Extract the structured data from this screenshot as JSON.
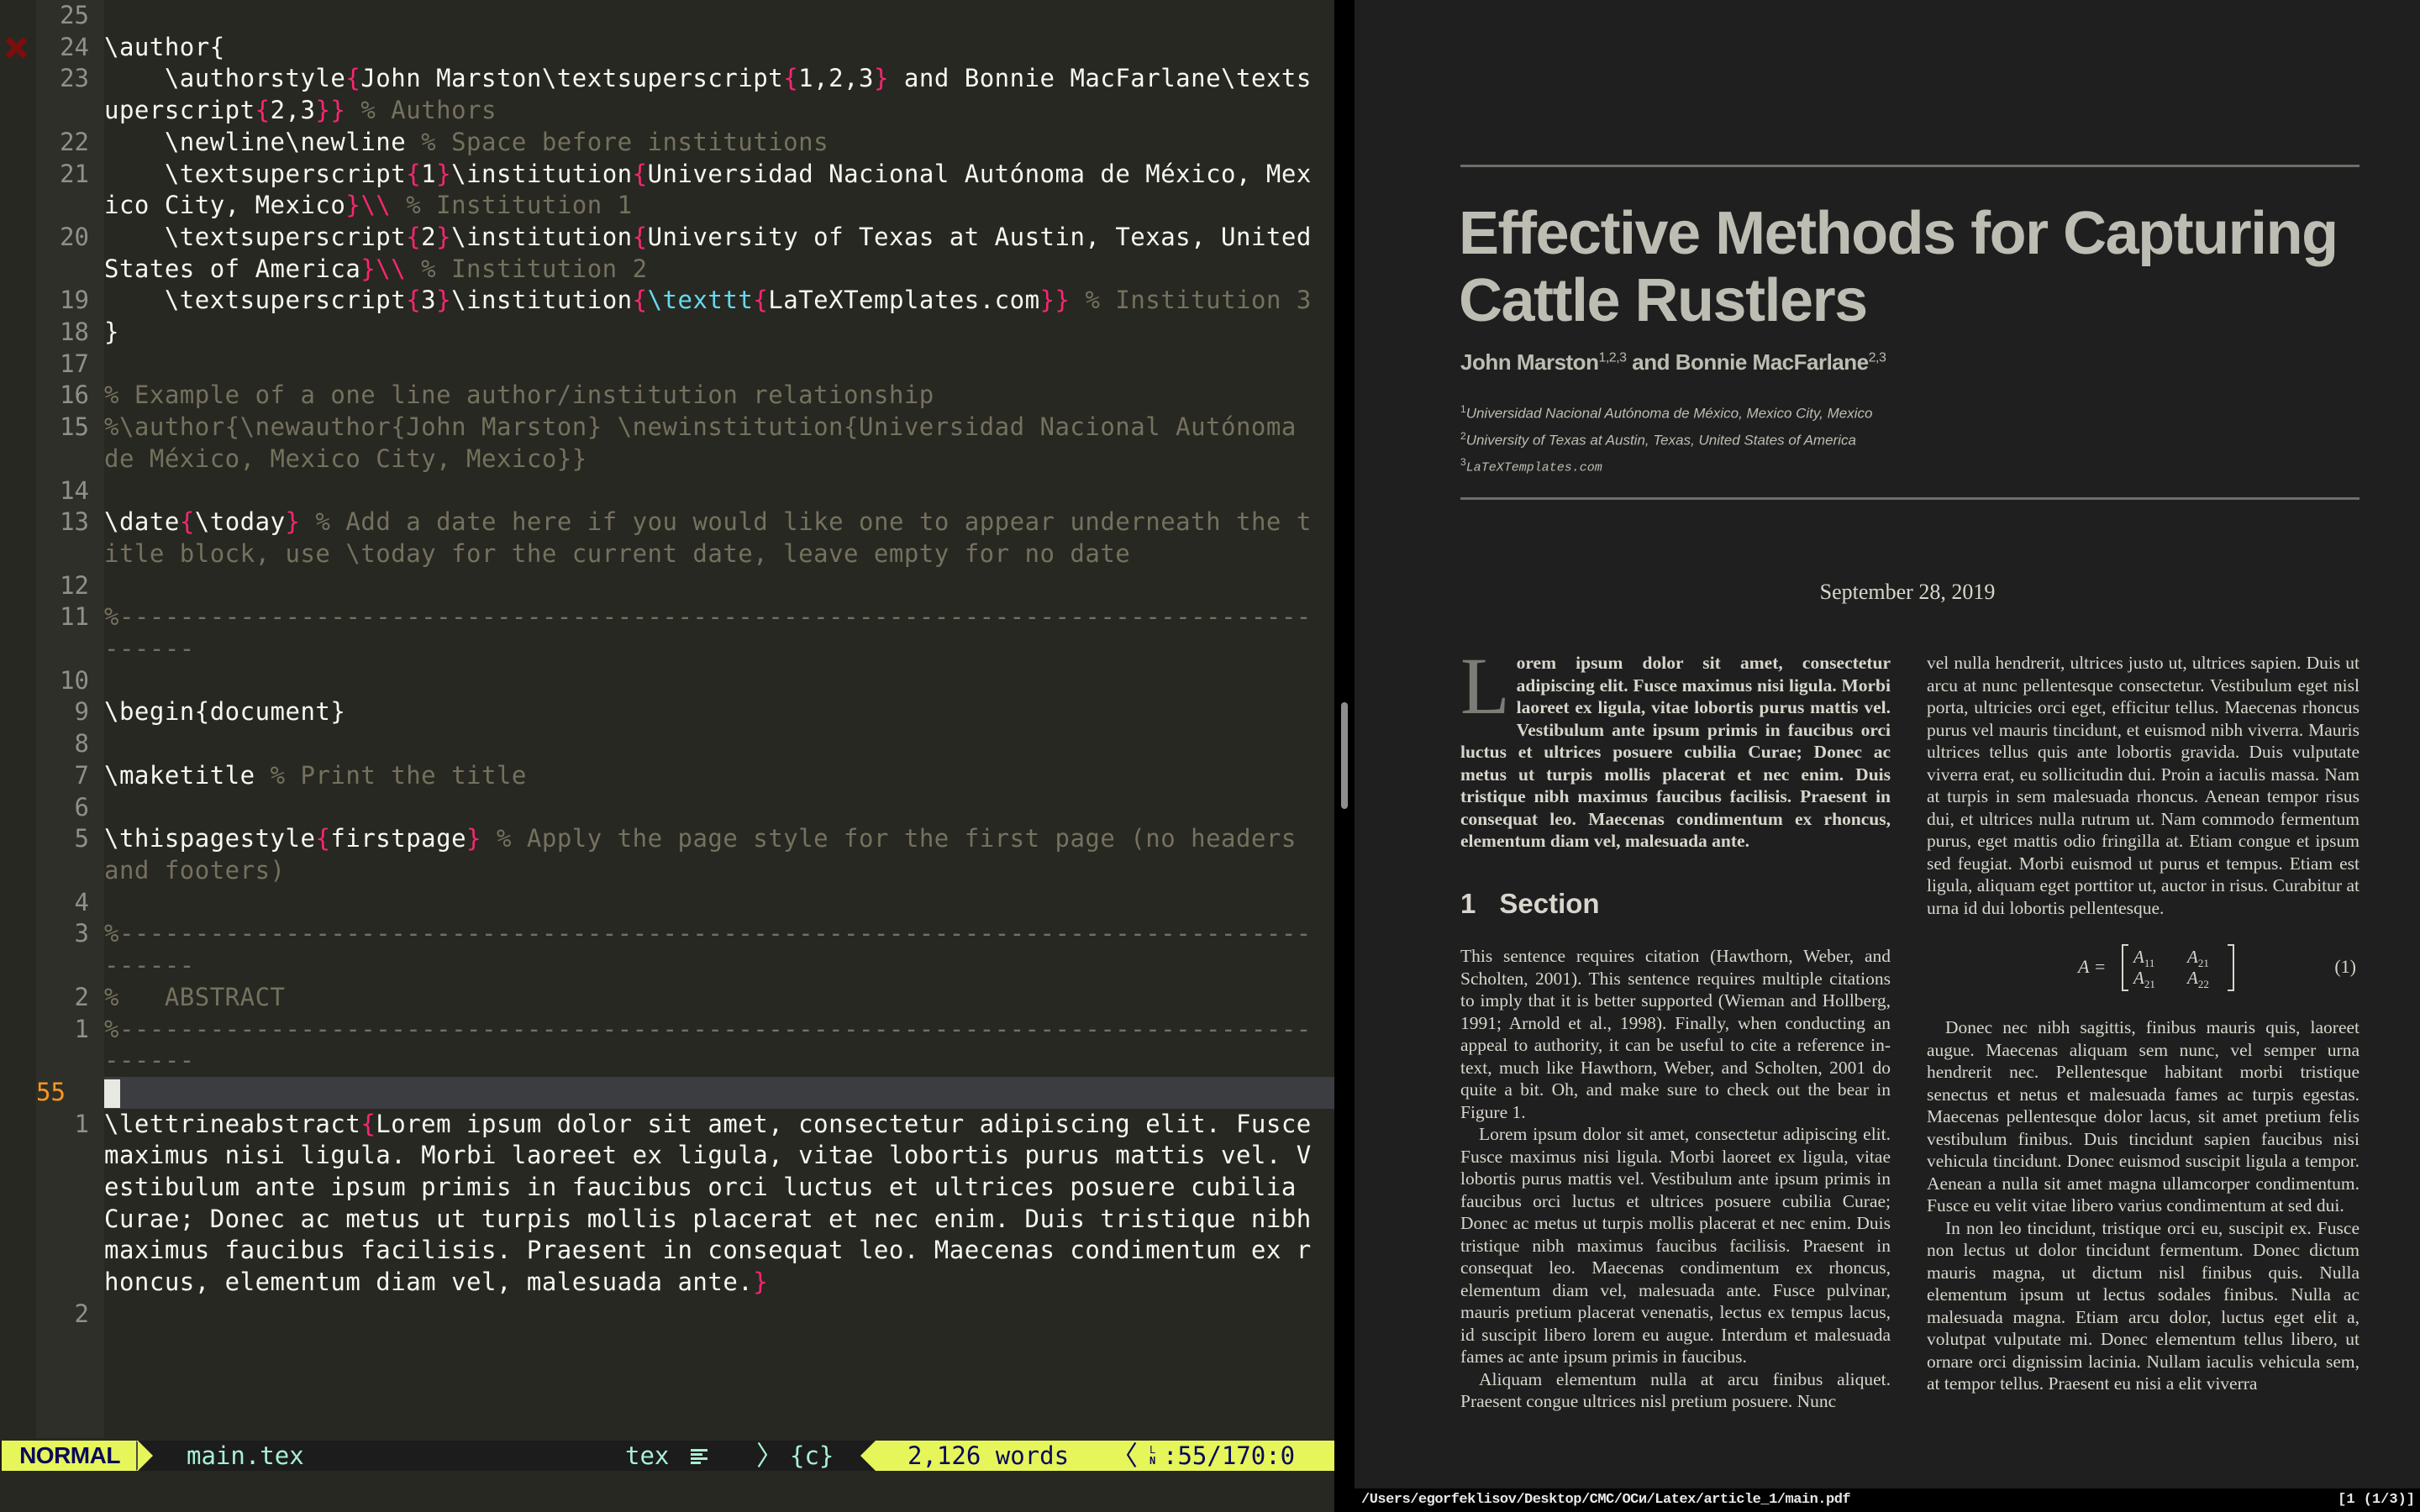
{
  "editor": {
    "sign_icon": "error-x-icon",
    "lines": [
      {
        "ln": "25",
        "segs": []
      },
      {
        "ln": "24",
        "sign": true,
        "segs": [
          [
            "t",
            "\\author"
          ],
          [
            "t",
            "{"
          ]
        ]
      },
      {
        "ln": "23",
        "segs": [
          [
            "t",
            "    \\authorstyle"
          ],
          [
            "b",
            "{"
          ],
          [
            "t",
            "John Marston\\textsuperscript"
          ],
          [
            "b",
            "{"
          ],
          [
            "t",
            "1,2,3"
          ],
          [
            "b",
            "}"
          ],
          [
            "t",
            " and Bonnie MacFarlane\\textsuperscript"
          ],
          [
            "b",
            "{"
          ],
          [
            "t",
            "2,3"
          ],
          [
            "b",
            "}}"
          ],
          [
            "t",
            " "
          ],
          [
            "c",
            "% Authors"
          ]
        ]
      },
      {
        "ln": "22",
        "segs": [
          [
            "t",
            "    \\newline\\newline "
          ],
          [
            "c",
            "% Space before institutions"
          ]
        ]
      },
      {
        "ln": "21",
        "segs": [
          [
            "t",
            "    \\textsuperscript"
          ],
          [
            "b",
            "{"
          ],
          [
            "t",
            "1"
          ],
          [
            "b",
            "}"
          ],
          [
            "t",
            "\\institution"
          ],
          [
            "b",
            "{"
          ],
          [
            "t",
            "Universidad Nacional Autónoma de México, Mexico City, Mexico"
          ],
          [
            "b",
            "}\\\\"
          ],
          [
            "t",
            " "
          ],
          [
            "c",
            "% Institution 1"
          ]
        ]
      },
      {
        "ln": "20",
        "segs": [
          [
            "t",
            "    \\textsuperscript"
          ],
          [
            "b",
            "{"
          ],
          [
            "t",
            "2"
          ],
          [
            "b",
            "}"
          ],
          [
            "t",
            "\\institution"
          ],
          [
            "b",
            "{"
          ],
          [
            "t",
            "University of Texas at Austin, Texas, United States of America"
          ],
          [
            "b",
            "}\\\\"
          ],
          [
            "t",
            " "
          ],
          [
            "c",
            "% Institution 2"
          ]
        ]
      },
      {
        "ln": "19",
        "segs": [
          [
            "t",
            "    \\textsuperscript"
          ],
          [
            "b",
            "{"
          ],
          [
            "t",
            "3"
          ],
          [
            "b",
            "}"
          ],
          [
            "t",
            "\\institution"
          ],
          [
            "b",
            "{"
          ],
          [
            "k",
            "\\texttt"
          ],
          [
            "b",
            "{"
          ],
          [
            "t",
            "LaTeXTemplates.com"
          ],
          [
            "b",
            "}}"
          ],
          [
            "t",
            " "
          ],
          [
            "c",
            "% Institution 3"
          ]
        ]
      },
      {
        "ln": "18",
        "segs": [
          [
            "t",
            "}"
          ]
        ]
      },
      {
        "ln": "17",
        "segs": []
      },
      {
        "ln": "16",
        "segs": [
          [
            "c",
            "% Example of a one line author/institution relationship"
          ]
        ]
      },
      {
        "ln": "15",
        "segs": [
          [
            "c",
            "%\\author{\\newauthor{John Marston} \\newinstitution{Universidad Nacional Autónoma de México, Mexico City, Mexico}}"
          ]
        ]
      },
      {
        "ln": "14",
        "segs": []
      },
      {
        "ln": "13",
        "segs": [
          [
            "t",
            "\\date"
          ],
          [
            "b",
            "{"
          ],
          [
            "t",
            "\\today"
          ],
          [
            "b",
            "}"
          ],
          [
            "t",
            " "
          ],
          [
            "c",
            "% Add a date here if you would like one to appear underneath the title block, use \\today for the current date, leave empty for no date"
          ]
        ]
      },
      {
        "ln": "12",
        "segs": []
      },
      {
        "ln": "11",
        "segs": [
          [
            "c",
            "%-------------------------------------------------------------------------------------"
          ]
        ]
      },
      {
        "ln": "10",
        "segs": []
      },
      {
        "ln": "9",
        "segs": [
          [
            "t",
            "\\begin{document}"
          ]
        ]
      },
      {
        "ln": "8",
        "segs": []
      },
      {
        "ln": "7",
        "segs": [
          [
            "t",
            "\\maketitle "
          ],
          [
            "c",
            "% Print the title"
          ]
        ]
      },
      {
        "ln": "6",
        "segs": []
      },
      {
        "ln": "5",
        "segs": [
          [
            "t",
            "\\thispagestyle"
          ],
          [
            "b",
            "{"
          ],
          [
            "t",
            "firstpage"
          ],
          [
            "b",
            "}"
          ],
          [
            "t",
            " "
          ],
          [
            "c",
            "% Apply the page style for the first page (no headers and footers)"
          ]
        ]
      },
      {
        "ln": "4",
        "segs": []
      },
      {
        "ln": "3",
        "segs": [
          [
            "c",
            "%-------------------------------------------------------------------------------------"
          ]
        ]
      },
      {
        "ln": "2",
        "segs": [
          [
            "c",
            "%   ABSTRACT"
          ]
        ]
      },
      {
        "ln": "1",
        "segs": [
          [
            "c",
            "%-------------------------------------------------------------------------------------"
          ]
        ]
      },
      {
        "ln": "55",
        "cursor": true,
        "segs": []
      },
      {
        "ln": "1",
        "segs": [
          [
            "t",
            "\\lettrineabstract"
          ],
          [
            "b",
            "{"
          ],
          [
            "t",
            "Lorem ipsum dolor sit amet, consectetur adipiscing elit. Fusce maximus nisi ligula. Morbi laoreet ex ligula, vitae lobortis purus mattis vel. Vestibulum ante ipsum primis in faucibus orci luctus et ultrices posuere cubilia Curae; Donec ac metus ut turpis mollis placerat et nec enim. Duis tristique nibh maximus faucibus facilisis. Praesent in consequat leo. Maecenas condimentum ex rhoncus, elementum diam vel, malesuada ante."
          ],
          [
            "b",
            "}"
          ]
        ]
      },
      {
        "ln": "2",
        "segs": []
      }
    ]
  },
  "statusline": {
    "mode": "NORMAL",
    "filename": "main.tex",
    "filetype": "tex",
    "filetype_icon": "align-left-icon",
    "context": "{c}",
    "word_count": "2,126 words",
    "line_icon": "line-number-icon",
    "line_icon_text": "LN",
    "position": ":55/170:0",
    "colors": {
      "mode_bg": "#e6f55a",
      "mode_fg": "#0a0a5a",
      "info_fg": "#a8f0d4"
    }
  },
  "pdf": {
    "title": "Effective Methods for Capturing Cattle Rustlers",
    "authors": [
      {
        "name": "John Marston",
        "sup": "1,2,3"
      },
      {
        "connector": " and "
      },
      {
        "name": "Bonnie MacFarlane",
        "sup": "2,3"
      }
    ],
    "affiliations": [
      {
        "sup": "1",
        "text": "Universidad Nacional Autónoma de México, Mexico City, Mexico"
      },
      {
        "sup": "2",
        "text": "University of Texas at Austin, Texas, United States of America"
      },
      {
        "sup": "3",
        "text": "LaTeXTemplates.com",
        "mono": true
      }
    ],
    "date": "September 28, 2019",
    "abstract_dropcap": "L",
    "abstract": "orem ipsum dolor sit amet, consectetur adipiscing elit. Fusce maximus nisi ligula. Morbi laoreet ex ligula, vitae lobortis purus mattis vel. Vestibulum ante ipsum primis in faucibus orci luctus et ultrices posuere cubilia Curae; Donec ac metus ut turpis mollis placerat et nec enim. Duis tristique nibh maximus faucibus facilisis. Praesent in consequat leo. Maecenas condimentum ex rhoncus, elementum diam vel, malesuada ante.",
    "section": {
      "number": "1",
      "title": "Section"
    },
    "col1_paragraphs": [
      "This sentence requires citation (Hawthorn, Weber, and Scholten, 2001). This sentence requires multiple citations to imply that it is better supported (Wieman and Hollberg, 1991; Arnold et al., 1998). Finally, when conducting an appeal to authority, it can be useful to cite a reference in-text, much like Hawthorn, Weber, and Scholten, 2001 do quite a bit. Oh, and make sure to check out the bear in Figure 1.",
      "Lorem ipsum dolor sit amet, consectetur adipiscing elit. Fusce maximus nisi ligula. Morbi laoreet ex ligula, vitae lobortis purus mattis vel. Vestibulum ante ipsum primis in faucibus orci luctus et ultrices posuere cubilia Curae; Donec ac metus ut turpis mollis placerat et nec enim. Duis tristique nibh maximus faucibus facilisis. Praesent in consequat leo. Maecenas condimentum ex rhoncus, elementum diam vel, malesuada ante. Fusce pulvinar, mauris pretium placerat venenatis, lectus ex tempus lacus, id suscipit libero lorem eu augue. Interdum et malesuada fames ac ante ipsum primis in faucibus.",
      "Aliquam elementum nulla at arcu finibus aliquet. Praesent congue ultrices nisl pretium posuere. Nunc"
    ],
    "col2_top": "vel nulla hendrerit, ultrices justo ut, ultrices sapien. Duis ut arcu at nunc pellentesque consectetur. Vestibulum eget nisl porta, ultricies orci eget, efficitur tellus. Maecenas rhoncus purus vel mauris tincidunt, et euismod nibh viverra. Mauris ultrices tellus quis ante lobortis gravida. Duis vulputate viverra erat, eu sollicitudin dui. Proin a iaculis massa. Nam at turpis in sem malesuada rhoncus. Aenean tempor risus dui, et ultrices nulla rutrum ut. Nam commodo fermentum purus, eget mattis odio fringilla at. Etiam congue et ipsum sed feugiat. Morbi euismod ut purus et tempus. Etiam est ligula, aliquam eget porttitor ut, auctor in risus. Curabitur at urna id dui lobortis pellentesque.",
    "equation": {
      "lhs": "A =",
      "cells": [
        [
          "A",
          "11"
        ],
        [
          "A",
          "21"
        ],
        [
          "A",
          "21"
        ],
        [
          "A",
          "22"
        ]
      ],
      "number": "(1)"
    },
    "col2_paragraphs": [
      "Donec nec nibh sagittis, finibus mauris quis, laoreet augue. Maecenas aliquam sem nunc, vel semper urna hendrerit nec. Pellentesque habitant morbi tristique senectus et netus et malesuada fames ac turpis egestas. Maecenas pellentesque dolor lacus, sit amet pretium felis vestibulum finibus. Duis tincidunt sapien faucibus nisi vehicula tincidunt. Donec euismod suscipit ligula a tempor. Aenean a nulla sit amet magna ullamcorper condimentum. Fusce eu velit vitae libero varius condimentum at sed dui.",
      "In non leo tincidunt, tristique orci eu, suscipit ex. Fusce non lectus ut dolor tincidunt fermentum. Donec dictum mauris magna, ut dictum nisl finibus quis. Nulla elementum ipsum ut lectus sodales finibus. Nulla ac malesuada magna. Etiam arcu dolor, luctus eget elit a, volutpat vulputate mi. Donec elementum tellus libero, ut ornare orci dignissim lacinia. Nullam iaculis vehicula sem, at tempor tellus. Praesent eu nisi a elit viverra"
    ],
    "status": {
      "path": "/Users/egorfeklisov/Desktop/CMC/ОСи/Latex/article_1/main.pdf",
      "page": "[1 (1/3)]"
    }
  }
}
